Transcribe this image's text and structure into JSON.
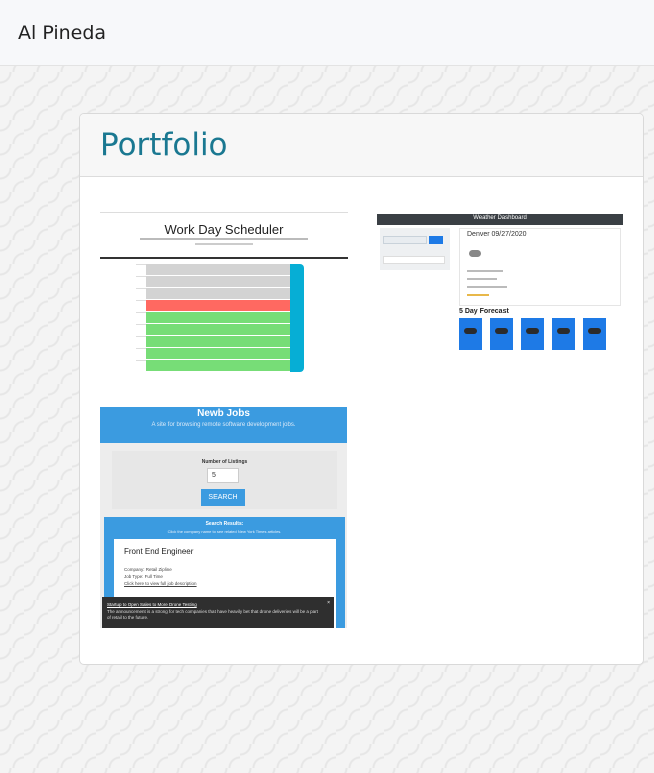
{
  "navbar": {
    "brand": "Al Pineda"
  },
  "portfolio": {
    "title": "Portfolio",
    "projects": {
      "scheduler": {
        "title": "Work Day Scheduler"
      },
      "weather": {
        "header": "Weather Dashboard",
        "city_date": "Denver 09/27/2020",
        "forecast_heading": "5 Day Forecast"
      },
      "jobs": {
        "title": "Newb Jobs",
        "subtitle": "A site for browsing remote software development jobs.",
        "listings_label": "Number of Listings",
        "listings_value": "5",
        "search_button": "SEARCH",
        "results_title": "Search Results:",
        "results_sub": "Click the company name to see related New York Times articles.",
        "job_title": "Front End Engineer",
        "company": "Company: Retail Zipline",
        "job_type": "Job Type: Full Time",
        "job_link": "Click here to view full job description",
        "toast_title": "Startup to Open Sales to More Drone Testing",
        "toast_body": "The announcement is a strong for tech companies that have heavily bet that drone deliveries will be a part of retail to the future.",
        "toast_close": "×"
      }
    }
  }
}
